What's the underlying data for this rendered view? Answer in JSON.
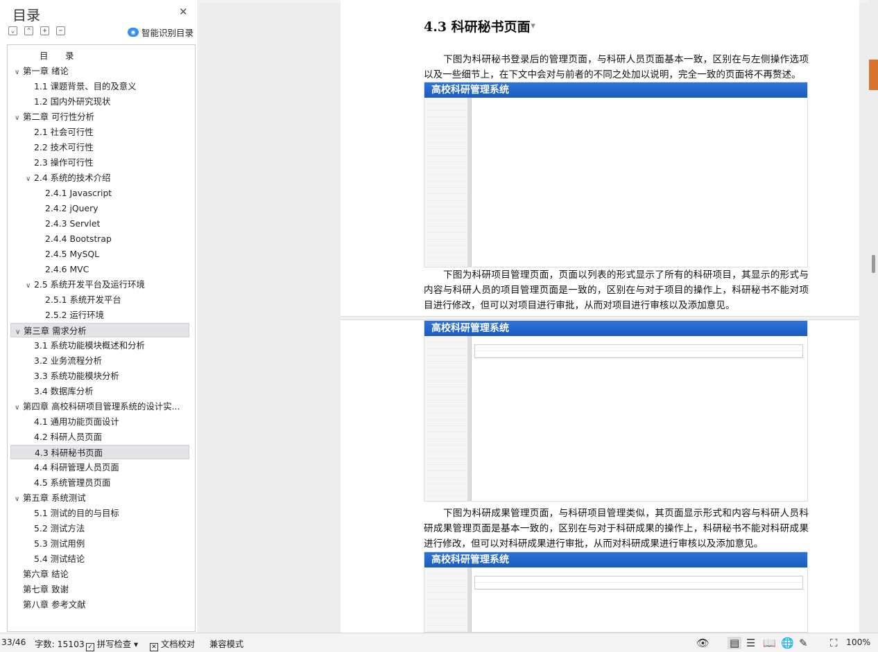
{
  "sidebar": {
    "title": "目录",
    "smart_label": "智能识别目录"
  },
  "toc": [
    {
      "text": "目　　录",
      "level": 1,
      "caret": false
    },
    {
      "text": "第一章  绪论",
      "level": 0,
      "caret": true
    },
    {
      "text": "1.1  课题背景、目的及意义",
      "level": 1,
      "caret": false
    },
    {
      "text": "1.2  国内外研究现状",
      "level": 1,
      "caret": false
    },
    {
      "text": "第二章  可行性分析",
      "level": 0,
      "caret": true
    },
    {
      "text": "2.1  社会可行性",
      "level": 1,
      "caret": false
    },
    {
      "text": "2.2  技术可行性",
      "level": 1,
      "caret": false
    },
    {
      "text": "2.3  操作可行性",
      "level": 1,
      "caret": false
    },
    {
      "text": "2.4  系统的技术介绍",
      "level": 1,
      "caret": true
    },
    {
      "text": "2.4.1 Javascript",
      "level": 2,
      "caret": false
    },
    {
      "text": "2.4.2 jQuery",
      "level": 2,
      "caret": false
    },
    {
      "text": "2.4.3 Servlet",
      "level": 2,
      "caret": false
    },
    {
      "text": "2.4.4 Bootstrap",
      "level": 2,
      "caret": false
    },
    {
      "text": "2.4.5 MySQL",
      "level": 2,
      "caret": false
    },
    {
      "text": "2.4.6 MVC",
      "level": 2,
      "caret": false
    },
    {
      "text": "2.5  系统开发平台及运行环境",
      "level": 1,
      "caret": true
    },
    {
      "text": "2.5.1  系统开发平台",
      "level": 2,
      "caret": false
    },
    {
      "text": "2.5.2  运行环境",
      "level": 2,
      "caret": false
    },
    {
      "text": "第三章  需求分析",
      "level": 0,
      "caret": true,
      "selected": true
    },
    {
      "text": "3.1  系统功能模块概述和分析",
      "level": 1,
      "caret": false
    },
    {
      "text": "3.2  业务流程分析",
      "level": 1,
      "caret": false
    },
    {
      "text": "3.3  系统功能模块分析",
      "level": 1,
      "caret": false
    },
    {
      "text": "3.4  数据库分析",
      "level": 1,
      "caret": false
    },
    {
      "text": "第四章  高校科研项目管理系统的设计实...",
      "level": 0,
      "caret": true
    },
    {
      "text": "4.1    通用功能页面设计",
      "level": 1,
      "caret": false
    },
    {
      "text": "4.2    科研人员页面",
      "level": 1,
      "caret": false
    },
    {
      "text": "4.3    科研秘书页面",
      "level": 1,
      "caret": false,
      "selected": true
    },
    {
      "text": "4.4    科研管理人员页面",
      "level": 1,
      "caret": false
    },
    {
      "text": "4.5    系统管理员页面",
      "level": 1,
      "caret": false
    },
    {
      "text": "第五章  系统测试",
      "level": 0,
      "caret": true
    },
    {
      "text": "5.1  测试的目的与目标",
      "level": 1,
      "caret": false
    },
    {
      "text": "5.2  测试方法",
      "level": 1,
      "caret": false
    },
    {
      "text": "5.3  测试用例",
      "level": 1,
      "caret": false
    },
    {
      "text": "5.4  测试结论",
      "level": 1,
      "caret": false
    },
    {
      "text": "第六章  结论",
      "level": 0,
      "caret": false
    },
    {
      "text": "第七章  致谢",
      "level": 0,
      "caret": false
    },
    {
      "text": "第八章  参考文献",
      "level": 0,
      "caret": false
    }
  ],
  "doc": {
    "heading": "4.3    科研秘书页面",
    "para1": "下图为科研秘书登录后的管理页面，与科研人员页面基本一致，区别在与左侧操作选项以及一些细节上，在下文中会对与前者的不同之处加以说明，完全一致的页面将不再赘述。",
    "para2": "下图为科研项目管理页面，页面以列表的形式显示了所有的科研项目，其显示的形式与内容与科研人员的项目管理页面是一致的，区别在与对于项目的操作上，科研秘书不能对项目进行修改，但可以对项目进行审批，从而对项目进行审核以及添加意见。",
    "para3": "下图为科研成果管理页面，与科研项目管理类似，其页面显示形式和内容与科研人员科研成果管理页面是基本一致的，区别在与对于科研成果的操作上，科研秘书不能对科研成果进行修改，但可以对科研成果进行审批，从而对科研成果进行审核以及添加意见。",
    "shot_title": "高校科研管理系统"
  },
  "status": {
    "page": "33/46",
    "words": "字数: 15103",
    "spell": "拼写检查",
    "proof": "文档校对",
    "compat": "兼容模式",
    "zoom": "100%"
  }
}
